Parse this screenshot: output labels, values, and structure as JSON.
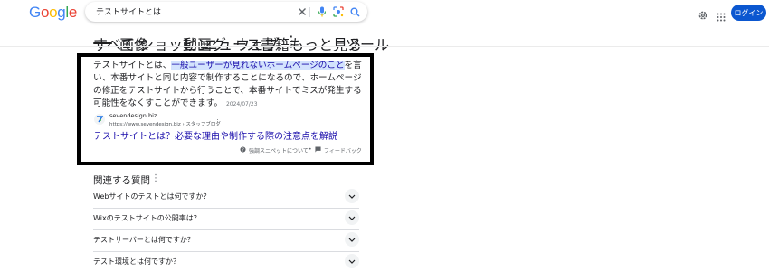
{
  "logo": {
    "text": "Google",
    "letters": [
      {
        "ch": "G",
        "color": "#4285f4"
      },
      {
        "ch": "o",
        "color": "#ea4335"
      },
      {
        "ch": "o",
        "color": "#fbbc05"
      },
      {
        "ch": "g",
        "color": "#4285f4"
      },
      {
        "ch": "l",
        "color": "#34a853"
      },
      {
        "ch": "e",
        "color": "#ea4335"
      }
    ]
  },
  "search": {
    "query": "テストサイトとは",
    "icons": [
      "clear-icon",
      "voice-search-icon",
      "lens-icon",
      "search-icon"
    ]
  },
  "header": {
    "login_label": "ログイン",
    "icons": [
      "settings-icon",
      "apps-grid-icon"
    ]
  },
  "tabs": {
    "items": [
      "すべて",
      "画像",
      "ショッピング",
      "動画",
      "ニュース",
      "ウェブ",
      "書籍",
      "もっと見る"
    ],
    "active_index": 0,
    "tools_label": "ツール"
  },
  "snippet": {
    "text_before": "テストサイトとは、",
    "text_highlight": "一般ユーザーが見れないホームページのこと",
    "text_after": "を言い、本番サイトと同じ内容で制作することになるので、ホームページの修正をテストサイトから行うことで、本番サイトでミスが発生する可能性をなくすことができます。",
    "date": "2024/07/23",
    "site_name": "sevendesign.biz",
    "site_url": "https://www.sevendesign.biz › スタッフブログ",
    "result_title": "テストサイトとは？必要な理由や制作する際の注意点を解説",
    "about_label": "強調スニペットについて",
    "feedback_label": "フィードバック"
  },
  "paa": {
    "title": "関連する質問",
    "questions": [
      "Webサイトのテストとは何ですか？",
      "Wixのテストサイトの公開率は？",
      "テストサーバーとは何ですか？",
      "テスト環境とは何ですか？"
    ]
  },
  "colors": {
    "accent": "#0b57d0",
    "link": "#1a0dab",
    "highlight": "#d3e3fd",
    "frame": "#000000"
  }
}
